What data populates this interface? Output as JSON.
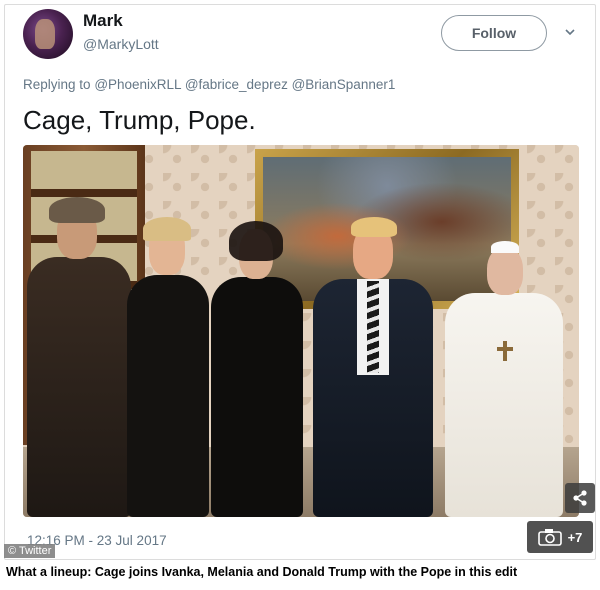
{
  "tweet": {
    "display_name": "Mark",
    "handle": "@MarkyLott",
    "follow_label": "Follow",
    "reply_prefix": "Replying to",
    "reply_mentions": "@PhoenixRLL @fabrice_deprez @BrianSpanner1",
    "text": "Cage, Trump, Pope.",
    "timestamp": "12:16 PM - 23 Jul 2017"
  },
  "photo": {
    "extra_photos_label": "+7",
    "icons": [
      "camera-icon",
      "share-icon",
      "chevron-down-icon"
    ]
  },
  "source_badge": "© Twitter",
  "caption": "What a lineup: Cage joins Ivanka, Melania and Donald Trump with the Pope in this edit",
  "colors": {
    "text_primary": "#14171a",
    "text_secondary": "#657786",
    "border": "#dcdcdc"
  }
}
